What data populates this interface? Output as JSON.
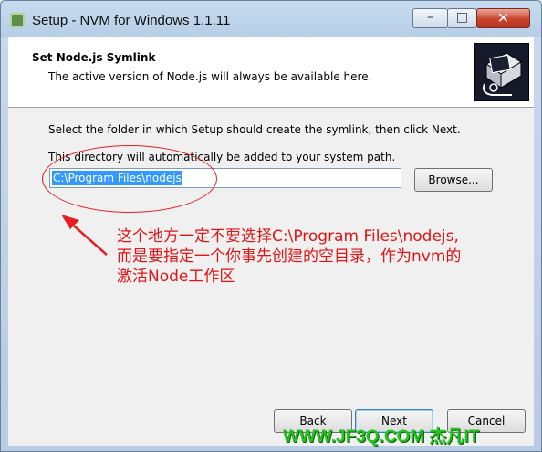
{
  "window": {
    "title": "Setup - NVM for Windows 1.1.11",
    "controls": {
      "minimize": "–",
      "maximize": "□",
      "close": "✕"
    }
  },
  "header": {
    "title": "Set Node.js Symlink",
    "subtitle": "The active version of Node.js will always be available here."
  },
  "content": {
    "instruction": "Select the folder in which Setup should create the symlink, then click Next.",
    "path_note": "This directory will automatically be added to your system path.",
    "path_value": "C:\\Program Files\\nodejs",
    "browse_label": "Browse..."
  },
  "buttons": {
    "back": "Back",
    "next": "Next",
    "cancel": "Cancel"
  },
  "annotation": {
    "lines": [
      "这个地方一定不要选择C:\\Program Files\\nodejs,",
      "而是要指定一个你事先创建的空目录，作为nvm的",
      "激活Node工作区"
    ],
    "color": "#e01414"
  },
  "watermark": "WWW.JF3Q.COM 杰凡IT",
  "icons": {
    "app": "app-icon",
    "logo": "installer-logo"
  }
}
